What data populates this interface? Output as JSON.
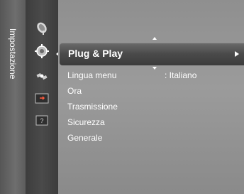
{
  "sidebar": {
    "section_label": "Impostazione",
    "icons": [
      {
        "name": "satellite-dish-icon"
      },
      {
        "name": "gear-icon"
      },
      {
        "name": "satellite-icon"
      },
      {
        "name": "input-icon"
      },
      {
        "name": "help-icon",
        "glyph": "?"
      }
    ]
  },
  "menu": {
    "highlighted": {
      "label": "Plug & Play"
    },
    "items": [
      {
        "label": "Lingua menu",
        "value": ": Italiano"
      },
      {
        "label": "Ora"
      },
      {
        "label": "Trasmissione"
      },
      {
        "label": "Sicurezza"
      },
      {
        "label": "Generale"
      }
    ]
  },
  "colors": {
    "rail": "#5f5f5f",
    "icon_column": "#444444",
    "panel": "#959595",
    "highlight": "#4a4a4a",
    "text": "#ffffff"
  }
}
